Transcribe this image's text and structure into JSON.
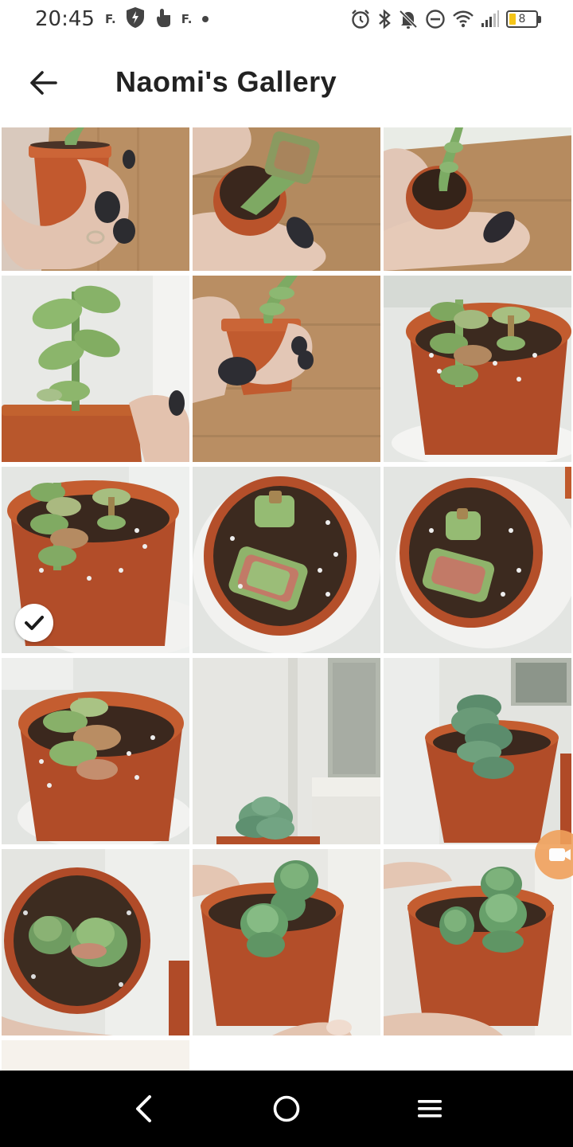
{
  "status_bar": {
    "time": "20:45",
    "left_icons": [
      "f-letter-icon",
      "shield-bolt-icon",
      "hand-touch-icon",
      "f-letter-icon",
      "dot-icon"
    ],
    "f_glyph": "F.",
    "battery_level": "8",
    "right_icons": [
      "alarm-icon",
      "bluetooth-icon",
      "bell-off-icon",
      "do-not-disturb-icon",
      "wifi-icon",
      "signal-icon",
      "battery-icon"
    ]
  },
  "header": {
    "title": "Naomi's Gallery",
    "back_icon": "arrow-left-icon"
  },
  "gallery": {
    "photo_count": 16,
    "selected_photo_index": 6,
    "photos": [
      {
        "subject": "succulent in small pot held in hand",
        "selected": false
      },
      {
        "subject": "succulent in small pot held in hand",
        "selected": false
      },
      {
        "subject": "succulent in small pot held in hand",
        "selected": false
      },
      {
        "subject": "succulent close-up",
        "selected": false
      },
      {
        "subject": "succulent in small pot held in hand",
        "selected": false
      },
      {
        "subject": "succulent in orange pot",
        "selected": false
      },
      {
        "subject": "succulent in orange pot",
        "selected": true
      },
      {
        "subject": "succulent in orange pot top view",
        "selected": false
      },
      {
        "subject": "succulent in orange pot top view",
        "selected": false
      },
      {
        "subject": "succulent in orange pot",
        "selected": false
      },
      {
        "subject": "succulent by window",
        "selected": false
      },
      {
        "subject": "succulent in orange pot",
        "selected": false
      },
      {
        "subject": "succulent in orange pot",
        "selected": false
      },
      {
        "subject": "succulent in orange pot held in hand",
        "selected": false
      },
      {
        "subject": "succulent in orange pot held in hand",
        "selected": false
      },
      {
        "subject": "blank photo",
        "selected": false
      }
    ],
    "camera_button_icon": "camera-icon"
  },
  "nav_bar": {
    "items": [
      "back-triangle-icon",
      "home-circle-icon",
      "menu-lines-icon"
    ]
  },
  "colors": {
    "pot": "#b5502a",
    "soil": "#3b2a20",
    "succulent_green": "#7fae6a",
    "wood": "#b68d62",
    "accent_camera": "#f0a15c"
  }
}
